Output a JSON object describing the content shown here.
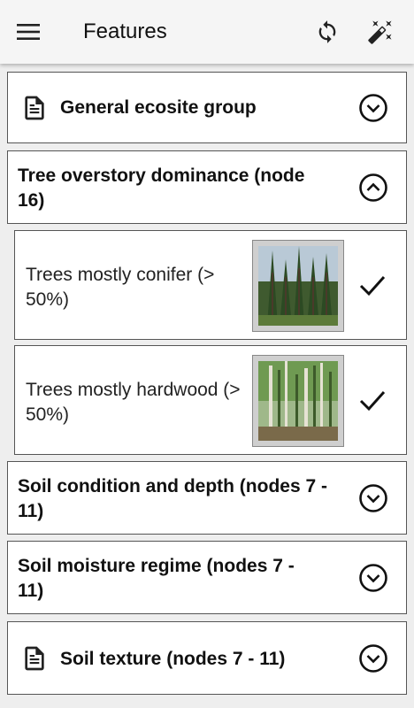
{
  "appbar": {
    "title": "Features",
    "menu_icon": "menu-icon",
    "refresh_icon": "refresh-icon",
    "magic_icon": "magic-wand-icon"
  },
  "sections": [
    {
      "label": "General ecosite group",
      "expanded": false,
      "icon": "document-icon"
    },
    {
      "label": "Tree overstory dominance (node 16)",
      "expanded": true
    },
    {
      "label": "Soil condition and depth (nodes 7 - 11)",
      "expanded": false
    },
    {
      "label": "Soil moisture regime (nodes 7 - 11)",
      "expanded": false
    },
    {
      "label": "Soil texture (nodes 7 - 11)",
      "expanded": false,
      "icon": "document-icon"
    }
  ],
  "options": [
    {
      "label": "Trees mostly conifer (> 50%)",
      "image": "conifer-forest-photo",
      "checked": true
    },
    {
      "label": "Trees mostly hardwood (> 50%)",
      "image": "hardwood-forest-photo",
      "checked": true
    }
  ],
  "colors": {
    "appbar": "#f5f5f5",
    "background": "#eeeeee",
    "border": "#555555"
  }
}
